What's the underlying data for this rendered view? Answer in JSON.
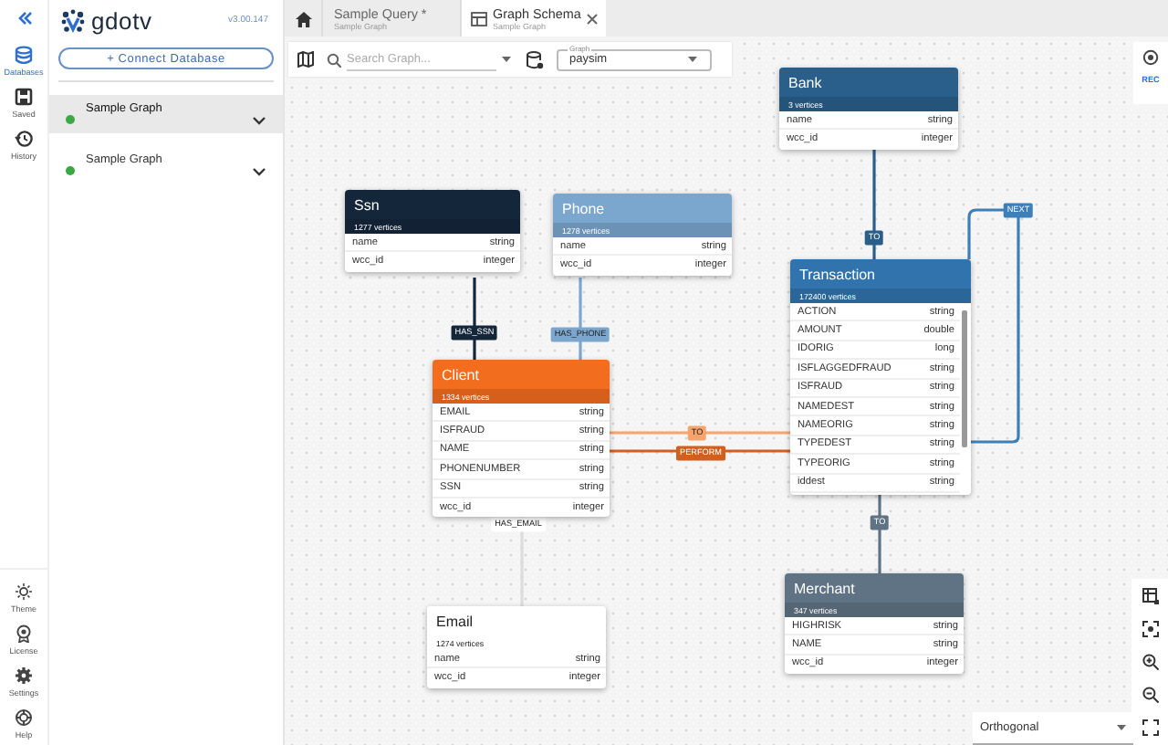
{
  "rail": {
    "items": [
      {
        "label": "Databases",
        "selected": true
      },
      {
        "label": "Saved",
        "selected": false
      },
      {
        "label": "History",
        "selected": false
      }
    ],
    "bottom_items": [
      {
        "label": "Theme"
      },
      {
        "label": "License"
      },
      {
        "label": "Settings"
      },
      {
        "label": "Help"
      }
    ]
  },
  "sidebar": {
    "logo": "gdotv",
    "version": "v3.00.147",
    "connect_button": "+ Connect Database",
    "databases": [
      {
        "name": "Sample Graph",
        "color": "#3aa845",
        "selected": true
      },
      {
        "name": "Sample Graph",
        "color": "#3aa845",
        "selected": false
      }
    ]
  },
  "tabs": [
    {
      "title": "Sample Query *",
      "subtitle": "Sample Graph",
      "selected": false
    },
    {
      "title": "Graph Schema",
      "subtitle": "Sample Graph",
      "selected": true
    }
  ],
  "toolbar": {
    "search": {
      "placeholder": "Search Graph..."
    },
    "graph_select": {
      "label": "Graph",
      "value": "paysim"
    }
  },
  "side_tools": {
    "rec": "REC"
  },
  "layout_select": {
    "value": "Orthogonal"
  },
  "nodes": [
    {
      "name": "Ssn",
      "count": "1277 vertices",
      "color": "#14263a",
      "fields": [
        {
          "name": "name",
          "type": "string"
        },
        {
          "name": "wcc_id",
          "type": "integer"
        }
      ]
    },
    {
      "name": "Phone",
      "count": "1278 vertices",
      "color": "#7ba7cf",
      "fields": [
        {
          "name": "name",
          "type": "string"
        },
        {
          "name": "wcc_id",
          "type": "integer"
        }
      ]
    },
    {
      "name": "Client",
      "count": "1334 vertices",
      "color": "#f36d1f",
      "fields": [
        {
          "name": "EMAIL",
          "type": "string"
        },
        {
          "name": "ISFRAUD",
          "type": "string"
        },
        {
          "name": "NAME",
          "type": "string"
        },
        {
          "name": "PHONENUMBER",
          "type": "string"
        },
        {
          "name": "SSN",
          "type": "string"
        },
        {
          "name": "wcc_id",
          "type": "integer"
        }
      ]
    },
    {
      "name": "Email",
      "count": "1274 vertices",
      "color": "#ffffff",
      "fields": [
        {
          "name": "name",
          "type": "string"
        },
        {
          "name": "wcc_id",
          "type": "integer"
        }
      ]
    },
    {
      "name": "Bank",
      "count": "3 vertices",
      "color": "#2a5f8c",
      "fields": [
        {
          "name": "name",
          "type": "string"
        },
        {
          "name": "wcc_id",
          "type": "integer"
        }
      ]
    },
    {
      "name": "Transaction",
      "count": "172400 vertices",
      "color": "#3174ad",
      "fields": [
        {
          "name": "ACTION",
          "type": "string"
        },
        {
          "name": "AMOUNT",
          "type": "double"
        },
        {
          "name": "IDORIG",
          "type": "long"
        },
        {
          "name": "ISFLAGGEDFRAUD",
          "type": "string"
        },
        {
          "name": "ISFRAUD",
          "type": "string"
        },
        {
          "name": "NAMEDEST",
          "type": "string"
        },
        {
          "name": "NAMEORIG",
          "type": "string"
        },
        {
          "name": "TYPEDEST",
          "type": "string"
        },
        {
          "name": "TYPEORIG",
          "type": "string"
        },
        {
          "name": "iddest",
          "type": "string"
        }
      ]
    },
    {
      "name": "Merchant",
      "count": "347 vertices",
      "color": "#5f7384",
      "fields": [
        {
          "name": "HIGHRISK",
          "type": "string"
        },
        {
          "name": "NAME",
          "type": "string"
        },
        {
          "name": "wcc_id",
          "type": "integer"
        }
      ]
    }
  ],
  "edges": [
    {
      "label": "HAS_SSN",
      "color": "#14263a"
    },
    {
      "label": "HAS_PHONE",
      "color": "#7ba7cf"
    },
    {
      "label": "HAS_EMAIL",
      "color": "#ffffff"
    },
    {
      "label": "TO",
      "color": "#f6a36c"
    },
    {
      "label": "PERFORM",
      "color": "#d25f1e"
    },
    {
      "label": "TO",
      "color": "#2a5f8c"
    },
    {
      "label": "NEXT",
      "color": "#3f7fb8"
    },
    {
      "label": "TO",
      "color": "#5f7384"
    }
  ]
}
